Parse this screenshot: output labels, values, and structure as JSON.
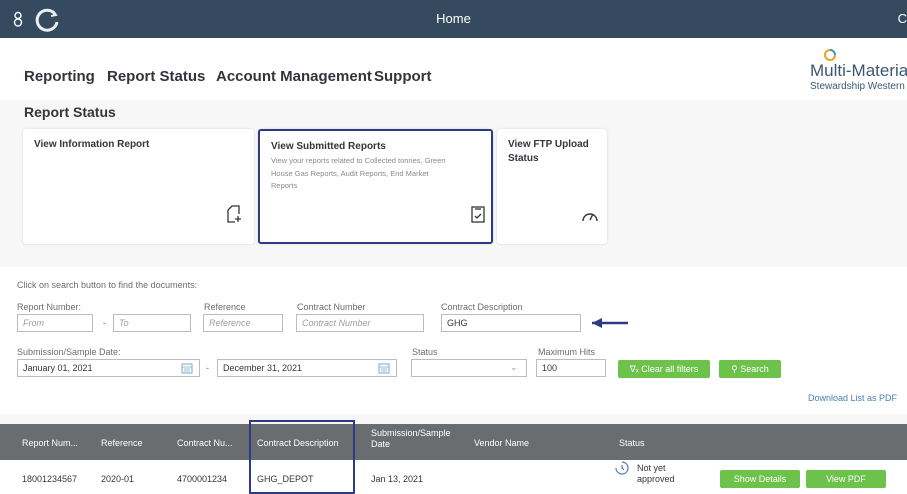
{
  "shell": {
    "title": "Home",
    "right_glyph": "C",
    "user_icon": "user-icon",
    "logo_icon": "refresh-logo-icon"
  },
  "nav": {
    "items": [
      "Reporting",
      "Report Status",
      "Account Management",
      "Support"
    ],
    "brand_name": "Multi-Materia",
    "brand_sub": "Stewardship Western"
  },
  "page": {
    "title": "Report Status"
  },
  "tiles": [
    {
      "title": "View Information Report",
      "subtitle": [],
      "icon": "document-add-icon"
    },
    {
      "title": "View Submitted Reports",
      "subtitle": [
        "View your reports related to Collected tonnes, Green",
        "House Gas Reports, Audit Reports, End Market",
        "Reports"
      ],
      "icon": "document-check-icon"
    },
    {
      "title": "View FTP Upload",
      "title2": "Status",
      "subtitle": [],
      "icon": "gauge-icon"
    }
  ],
  "filters": {
    "hint": "Click on search button to find the documents:",
    "report_number": {
      "label": "Report Number:",
      "from_placeholder": "From",
      "to_placeholder": "To",
      "dash": "-"
    },
    "reference": {
      "label": "Reference",
      "placeholder": "Reference"
    },
    "contract_number": {
      "label": "Contract Number",
      "placeholder": "Contract Number"
    },
    "contract_description": {
      "label": "Contract Description",
      "value": "GHG"
    },
    "date": {
      "label": "Submission/Sample Date:",
      "from": "January 01, 2021",
      "to": "December 31, 2021",
      "dash": "-"
    },
    "status": {
      "label": "Status",
      "value": ""
    },
    "max_hits": {
      "label": "Maximum Hits",
      "value": "100"
    },
    "clear_label": "Clear all filters",
    "search_label": "Search",
    "download_label": "Download List as PDF"
  },
  "table": {
    "headers": [
      "Report Num...",
      "Reference",
      "Contract Nu...",
      "Contract Description",
      "Submission/Sample",
      "Date",
      "Vendor Name",
      "Status"
    ],
    "rows": [
      {
        "report_number": "18001234567",
        "reference": "2020-01",
        "contract_number": "4700001234",
        "contract_description": "GHG_DEPOT",
        "date": "Jan 13, 2021",
        "vendor": "",
        "status_line1": "Not yet",
        "status_line2": "approved",
        "details_label": "Show Details",
        "pdf_label": "View PDF"
      }
    ]
  },
  "colors": {
    "shell": "#354a5f",
    "highlight": "#2d3a85",
    "green": "#6cc24a",
    "table_header": "#6a6d70"
  }
}
